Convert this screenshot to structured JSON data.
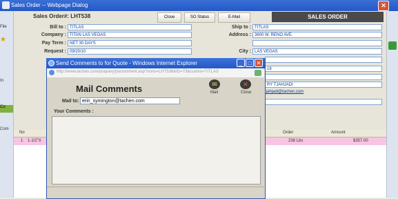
{
  "window": {
    "title": "Sales Order -- Webpage Dialog"
  },
  "header": {
    "order_label": "Sales Order#: LHT538",
    "buttons": [
      "Close",
      "SO Status",
      "E-Mail"
    ],
    "banner": "SALES ORDER"
  },
  "form": {
    "bill_to_label": "Bill to :",
    "bill_to": "TITLAS",
    "company_label": "Company :",
    "company": "TITAN LAS VEGAS",
    "pay_term_label": "Pay Term :",
    "pay_term": "NET 30 DAYS",
    "request_label": "Request :",
    "request": "09/20/10",
    "ship_to_label": "Ship to :",
    "ship_to": "TITLAS",
    "address_label": "Address :",
    "address": "3600 W. RENO AVE.",
    "city_label": "City :",
    "city": "LAS VEGAS",
    "value_18": "18",
    "contact": "RY TJAHJADI",
    "email_link": "tjahjadi@tachen.com"
  },
  "left_strip": {
    "fi": "File",
    "in": "In",
    "co": "Co",
    "com": "Com"
  },
  "table": {
    "headers": {
      "no": "No",
      "order": "Order",
      "amount": "Amount"
    },
    "rows": [
      {
        "no": "1",
        "item": "1-1/2\"X",
        "order": "238 Lbs",
        "amount": "$357.00"
      }
    ]
  },
  "dialog": {
    "title": "Send Comments to for Quote - Windows Internet Explorer",
    "url": "http://www.tachen.com/poquery/pocomment.asp?sono=LHT538&ID=73&custno=TITLAS",
    "heading": "Mail Comments",
    "mail_icon_label": "Mail",
    "close_icon_label": "Close",
    "mail_to_label": "Mail to:",
    "mail_to_value": "erin_symington@tachen.com",
    "comments_label": "Your Comments :"
  }
}
